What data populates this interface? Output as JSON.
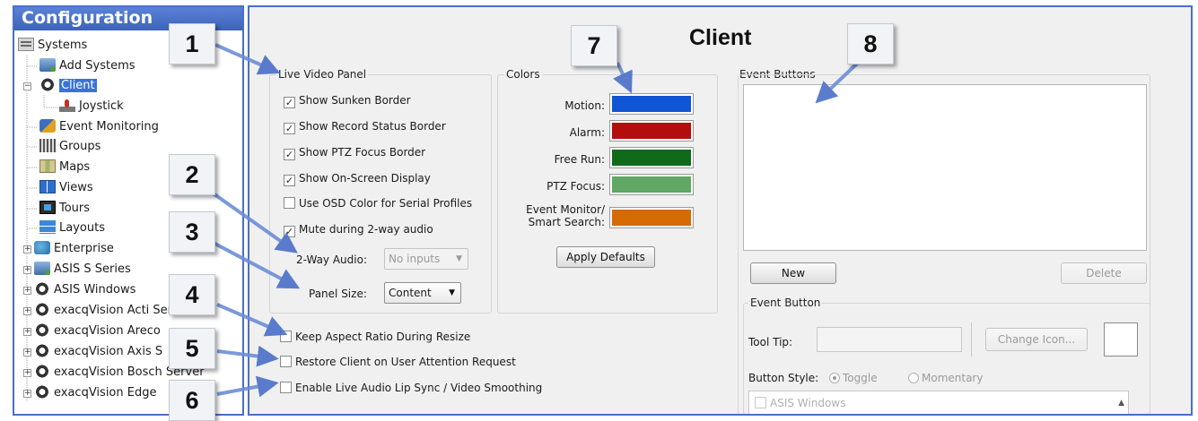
{
  "tree": {
    "header": "Configuration",
    "items": [
      {
        "label": "Systems",
        "icon": "systems-icon"
      },
      {
        "label": "Add Systems",
        "icon": "server-icon"
      },
      {
        "label": "Client",
        "icon": "gear-icon",
        "selected": true
      },
      {
        "label": "Joystick",
        "icon": "joystick-icon"
      },
      {
        "label": "Event Monitoring",
        "icon": "event-monitoring-icon"
      },
      {
        "label": "Groups",
        "icon": "groups-icon"
      },
      {
        "label": "Maps",
        "icon": "maps-icon"
      },
      {
        "label": "Views",
        "icon": "views-icon"
      },
      {
        "label": "Tours",
        "icon": "tours-icon"
      },
      {
        "label": "Layouts",
        "icon": "layouts-icon"
      },
      {
        "label": "Enterprise",
        "icon": "enterprise-icon"
      },
      {
        "label": "ASIS S Series",
        "icon": "server-icon"
      },
      {
        "label": "ASIS Windows",
        "icon": "gear-icon"
      },
      {
        "label": "exacqVision Acti Server",
        "icon": "gear-icon"
      },
      {
        "label": "exacqVision Areco",
        "icon": "gear-icon"
      },
      {
        "label": "exacqVision Axis S",
        "icon": "gear-icon"
      },
      {
        "label": "exacqVision Bosch Server",
        "icon": "gear-icon"
      },
      {
        "label": "exacqVision Edge",
        "icon": "gear-icon"
      }
    ]
  },
  "main": {
    "title": "Client",
    "live_video": {
      "title": "Live Video Panel",
      "checks": [
        {
          "label": "Show Sunken Border",
          "checked": true
        },
        {
          "label": "Show Record Status Border",
          "checked": true
        },
        {
          "label": "Show PTZ Focus Border",
          "checked": true
        },
        {
          "label": "Show On-Screen Display",
          "checked": true
        },
        {
          "label": "Use OSD Color for Serial Profiles",
          "checked": false
        },
        {
          "label": "Mute during 2-way audio",
          "checked": true
        }
      ],
      "two_way_audio_label": "2-Way Audio:",
      "two_way_audio_value": "No inputs",
      "panel_size_label": "Panel Size:",
      "panel_size_value": "Content"
    },
    "colors": {
      "title": "Colors",
      "items": [
        {
          "label": "Motion:",
          "color": "#0f55d6"
        },
        {
          "label": "Alarm:",
          "color": "#b30d0d"
        },
        {
          "label": "Free Run:",
          "color": "#0f6a1a"
        },
        {
          "label": "PTZ Focus:",
          "color": "#5fa763"
        },
        {
          "label": "Event Monitor/ Smart Search:",
          "color": "#d66a05"
        }
      ],
      "apply_defaults": "Apply Defaults"
    },
    "bottom_checks": [
      {
        "label": "Keep Aspect Ratio During Resize",
        "checked": false
      },
      {
        "label": "Restore Client on User Attention Request",
        "checked": false
      },
      {
        "label": "Enable Live Audio Lip Sync / Video Smoothing",
        "checked": false
      }
    ],
    "event_buttons": {
      "title": "Event Buttons",
      "new_label": "New",
      "delete_label": "Delete",
      "group_title": "Event Button",
      "tool_tip_label": "Tool Tip:",
      "change_icon_label": "Change Icon...",
      "button_style_label": "Button Style:",
      "toggle_label": "Toggle",
      "momentary_label": "Momentary",
      "list_item": "ASIS Windows"
    }
  },
  "callouts": [
    "1",
    "2",
    "3",
    "4",
    "5",
    "6",
    "7",
    "8"
  ]
}
